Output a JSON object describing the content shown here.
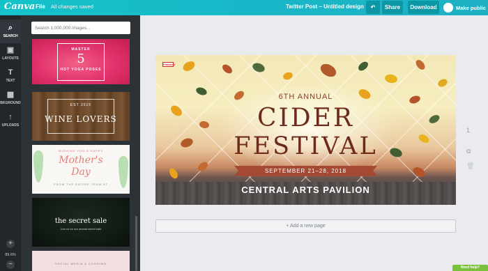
{
  "app": {
    "logo": "Canva",
    "file_menu": "File",
    "save_status": "All changes saved",
    "doc_title": "Twitter Post – Untitled design",
    "undo_label": "↶",
    "share_label": "Share",
    "download_label": "Download",
    "public_label": "Make public"
  },
  "rail": {
    "items": [
      {
        "label": "SEARCH",
        "icon": "⌕"
      },
      {
        "label": "LAYOUTS",
        "icon": "▣"
      },
      {
        "label": "TEXT",
        "icon": "T"
      },
      {
        "label": "BKGROUND",
        "icon": "▩"
      },
      {
        "label": "UPLOADS",
        "icon": "↑"
      }
    ],
    "zoom_in": "+",
    "zoom_level": "89.6%",
    "zoom_out": "−"
  },
  "panel": {
    "search_placeholder": "Search 1,000,000 images...",
    "templates": [
      {
        "line1": "MASTER",
        "line2": "5",
        "line3": "HOT YOGA POSES"
      },
      {
        "line1": "EST 2015",
        "line2": "WINE LOVERS"
      },
      {
        "line1": "WISHING YOU A HAPPY",
        "line2": "Mother's",
        "line3": "Day",
        "line4": "FROM THE ENTIRE TEAM AT"
      },
      {
        "line1": "the secret sale",
        "line2": "Join us for our annual secret sale"
      },
      {
        "line1": "SOCIAL MEDIA & COOKING"
      }
    ]
  },
  "design": {
    "badge": "Pinterest",
    "annual": "6TH ANNUAL",
    "title1": "CIDER",
    "title2": "FESTIVAL",
    "dates": "SEPTEMBER 21–28, 2018",
    "venue": "CENTRAL ARTS PAVILION",
    "colors": {
      "title": "#6e2a1d",
      "ribbon": "#a44a33",
      "accent": "#14c3c9"
    }
  },
  "canvas": {
    "page_number": "1",
    "copy_icon": "⧉",
    "delete_icon": "🗑",
    "add_page": "+ Add a new page",
    "help": "Need help?"
  }
}
